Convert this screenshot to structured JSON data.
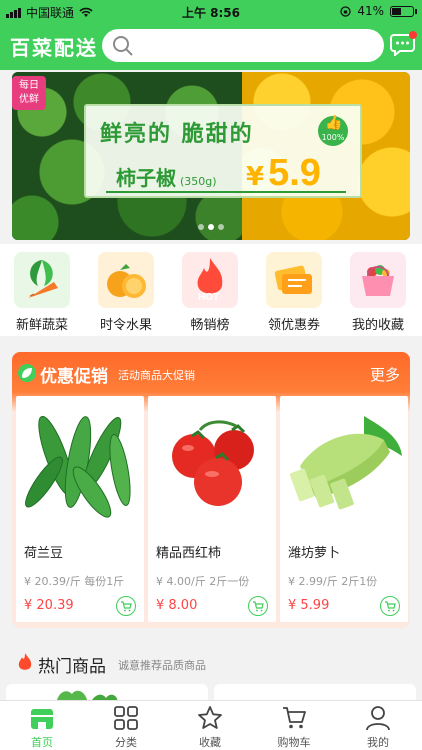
{
  "status_bar": {
    "carrier": "中国联通",
    "time": "上午 8:56",
    "battery_percent": "41%",
    "battery_level": 0.41
  },
  "header": {
    "logo": "百菜配送",
    "search_placeholder": ""
  },
  "banner": {
    "tag_line1": "每日",
    "tag_line2": "优鲜",
    "headline": "鲜亮的  脆甜的",
    "quality_badge": "100%",
    "product": "柿子椒",
    "weight": "(350g)",
    "currency": "¥",
    "price": "5.9",
    "slide_count": 3,
    "active_slide": 2
  },
  "categories": [
    {
      "label": "新鲜蔬菜",
      "icon": "vegetable-icon"
    },
    {
      "label": "时令水果",
      "icon": "orange-fruit-icon"
    },
    {
      "label": "畅销榜",
      "icon": "hot-flame-icon"
    },
    {
      "label": "领优惠券",
      "icon": "coupon-icon"
    },
    {
      "label": "我的收藏",
      "icon": "basket-icon"
    }
  ],
  "promotion": {
    "title": "优惠促销",
    "subtitle": "活动商品大促销",
    "more": "更多",
    "products": [
      {
        "name": "荷兰豆",
        "spec": "¥ 20.39/斤 每份1斤",
        "price": "¥ 20.39",
        "image": "snow-pea-icon"
      },
      {
        "name": "精品西红柿",
        "spec": "¥ 4.00/斤 2斤一份",
        "price": "¥ 8.00",
        "image": "tomato-icon"
      },
      {
        "name": "潍坊萝卜",
        "spec": "¥ 2.99/斤 2斤1份",
        "price": "¥ 5.99",
        "image": "radish-icon"
      }
    ]
  },
  "hot": {
    "title": "热门商品",
    "subtitle": "诚意推荐品质商品"
  },
  "tabbar": [
    {
      "label": "首页",
      "icon": "home-icon",
      "active": true
    },
    {
      "label": "分类",
      "icon": "category-grid-icon",
      "active": false
    },
    {
      "label": "收藏",
      "icon": "star-icon",
      "active": false
    },
    {
      "label": "购物车",
      "icon": "cart-icon",
      "active": false
    },
    {
      "label": "我的",
      "icon": "user-icon",
      "active": false
    }
  ],
  "colors": {
    "brand_green": "#3fcf5a",
    "promo_orange": "#ff6a2b",
    "price_red": "#ff4444",
    "banner_price_yellow": "#ffb400"
  }
}
